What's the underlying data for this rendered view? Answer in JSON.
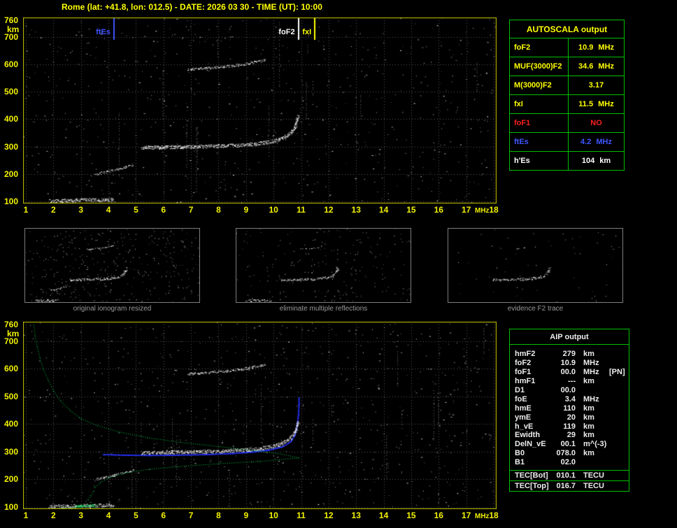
{
  "header": {
    "title": "Rome (lat: +41.8, lon: 012.5) - DATE: 2026 03 30 - TIME (UT): 10:00"
  },
  "axes": {
    "y_ticks": [
      "760",
      "700",
      "600",
      "500",
      "400",
      "300",
      "200",
      "100"
    ],
    "y_unit": "km",
    "x_ticks": [
      "1",
      "2",
      "3",
      "4",
      "5",
      "6",
      "7",
      "8",
      "9",
      "10",
      "11",
      "12",
      "13",
      "14",
      "15",
      "16",
      "17",
      "18"
    ],
    "x_unit": "MHz"
  },
  "autoscala": {
    "title": "AUTOSCALA output",
    "rows": [
      {
        "label": "foF2",
        "value": "10.9",
        "unit": "MHz",
        "color": "#ffff00"
      },
      {
        "label": "MUF(3000)F2",
        "value": "34.6",
        "unit": "MHz",
        "color": "#ffff00"
      },
      {
        "label": "M(3000)F2",
        "value": "3.17",
        "unit": "",
        "color": "#ffff00"
      },
      {
        "label": "fxI",
        "value": "11.5",
        "unit": "MHz",
        "color": "#ffff00"
      },
      {
        "label": "foF1",
        "value": "NO",
        "unit": "",
        "color": "#ff2020"
      },
      {
        "label": "ftEs",
        "value": "4.2",
        "unit": "MHz",
        "color": "#4055ff"
      },
      {
        "label": "h'Es",
        "value": "104",
        "unit": "km",
        "color": "#ffffff"
      }
    ]
  },
  "thumbnails": [
    {
      "caption": "original ionogram resized"
    },
    {
      "caption": "eliminate multiple reflections"
    },
    {
      "caption": "evidence F2 trace"
    }
  ],
  "aip": {
    "title": "AIP output",
    "rows": [
      {
        "label": "hmF2",
        "value": "279",
        "unit": "km",
        "extra": ""
      },
      {
        "label": "foF2",
        "value": "10.9",
        "unit": "MHz",
        "extra": ""
      },
      {
        "label": "foF1",
        "value": "00.0",
        "unit": "MHz",
        "extra": "[PN]"
      },
      {
        "label": "hmF1",
        "value": "---",
        "unit": "km",
        "extra": ""
      },
      {
        "label": "D1",
        "value": "00.0",
        "unit": "",
        "extra": ""
      },
      {
        "label": "foE",
        "value": "3.4",
        "unit": "MHz",
        "extra": ""
      },
      {
        "label": "hmE",
        "value": "110",
        "unit": "km",
        "extra": ""
      },
      {
        "label": "ymE",
        "value": "20",
        "unit": "km",
        "extra": ""
      },
      {
        "label": "h_vE",
        "value": "119",
        "unit": "km",
        "extra": ""
      },
      {
        "label": "Ewidth",
        "value": "29",
        "unit": "km",
        "extra": ""
      },
      {
        "label": "DelN_vE",
        "value": "00.1",
        "unit": "m^(-3)",
        "extra": ""
      },
      {
        "label": "B0",
        "value": "078.0",
        "unit": "km",
        "extra": ""
      },
      {
        "label": "B1",
        "value": "02.0",
        "unit": "",
        "extra": ""
      }
    ],
    "tec_rows": [
      {
        "label": "TEC[Bot]",
        "value": "010.1",
        "unit": "TECU"
      },
      {
        "label": "TEC[Top]",
        "value": "016.7",
        "unit": "TECU"
      }
    ]
  },
  "chart_data": {
    "type": "scatter",
    "title": "ionogram (virtual height km vs frequency MHz)",
    "x_axis": {
      "label": "MHz",
      "min": 1,
      "max": 18
    },
    "y_axis": {
      "label": "km",
      "min": 100,
      "max": 760
    },
    "markers": [
      {
        "label": "ftEs",
        "f_mhz": 4.2,
        "color": "#4055ff"
      },
      {
        "label": "foF2",
        "f_mhz": 10.9,
        "color": "#ffffff"
      },
      {
        "label": "fxI",
        "f_mhz": 11.5,
        "color": "#ffff00"
      }
    ],
    "traces": {
      "es": {
        "name": "Es layer trace",
        "color": "#ffffff",
        "thickness": 3,
        "density": 2.0,
        "points": [
          [
            1.85,
            103
          ],
          [
            2.6,
            104
          ],
          [
            3.3,
            106
          ],
          [
            4.2,
            106
          ]
        ]
      },
      "es_hop": {
        "name": "Es second reflection",
        "color": "#ffffff",
        "thickness": 2,
        "density": 1.1,
        "points": [
          [
            3.5,
            199
          ],
          [
            4.0,
            210
          ],
          [
            4.5,
            223
          ],
          [
            4.95,
            236
          ]
        ]
      },
      "f2": {
        "name": "F2 trace",
        "color": "#ffffff",
        "thickness": 3,
        "density": 2.2,
        "points": [
          [
            5.2,
            297
          ],
          [
            6.0,
            298
          ],
          [
            7.0,
            300
          ],
          [
            8.0,
            302
          ],
          [
            8.8,
            306
          ],
          [
            9.4,
            311
          ],
          [
            9.9,
            319
          ],
          [
            10.3,
            330
          ],
          [
            10.6,
            348
          ],
          [
            10.75,
            368
          ],
          [
            10.83,
            392
          ],
          [
            10.88,
            415
          ]
        ]
      },
      "f2_hop": {
        "name": "F2 second reflection",
        "color": "#ffffff",
        "thickness": 2,
        "density": 1.2,
        "points": [
          [
            6.9,
            582
          ],
          [
            7.6,
            587
          ],
          [
            8.3,
            593
          ],
          [
            8.9,
            600
          ],
          [
            9.3,
            608
          ],
          [
            9.7,
            616
          ]
        ]
      }
    },
    "profile": {
      "name": "electron density profile",
      "color": "#00d24b",
      "points": [
        [
          1.28,
          760
        ],
        [
          1.32,
          720
        ],
        [
          1.4,
          680
        ],
        [
          1.5,
          640
        ],
        [
          1.62,
          600
        ],
        [
          1.8,
          560
        ],
        [
          2.0,
          520
        ],
        [
          2.25,
          485
        ],
        [
          2.6,
          450
        ],
        [
          3.0,
          420
        ],
        [
          3.6,
          395
        ],
        [
          4.4,
          372
        ],
        [
          5.4,
          352
        ],
        [
          6.6,
          335
        ],
        [
          8.0,
          320
        ],
        [
          9.3,
          305
        ],
        [
          10.3,
          292
        ],
        [
          10.9,
          279
        ],
        [
          9.5,
          266
        ],
        [
          8.0,
          258
        ],
        [
          6.5,
          247
        ],
        [
          5.5,
          238
        ],
        [
          4.6,
          224
        ],
        [
          4.0,
          207
        ],
        [
          3.7,
          190
        ],
        [
          3.5,
          172
        ],
        [
          3.45,
          158
        ],
        [
          3.35,
          142
        ],
        [
          3.25,
          128
        ],
        [
          3.35,
          118
        ],
        [
          3.4,
          110
        ],
        [
          3.1,
          104
        ],
        [
          2.7,
          99
        ],
        [
          2.2,
          96
        ]
      ]
    },
    "restored_trace": {
      "name": "AUTOSCALA restored trace",
      "color": "#2633ff",
      "points": [
        [
          3.8,
          292
        ],
        [
          4.5,
          290
        ],
        [
          5.5,
          289
        ],
        [
          6.5,
          290
        ],
        [
          7.5,
          292
        ],
        [
          8.5,
          296
        ],
        [
          9.2,
          301
        ],
        [
          9.8,
          308
        ],
        [
          10.3,
          320
        ],
        [
          10.6,
          338
        ],
        [
          10.75,
          362
        ],
        [
          10.83,
          395
        ],
        [
          10.88,
          435
        ],
        [
          10.9,
          475
        ],
        [
          10.9,
          497
        ]
      ]
    },
    "es_overlay": {
      "name": "Es identified segment",
      "color": "#00d24b",
      "points": [
        [
          2.8,
          103
        ],
        [
          3.6,
          105
        ]
      ]
    }
  }
}
